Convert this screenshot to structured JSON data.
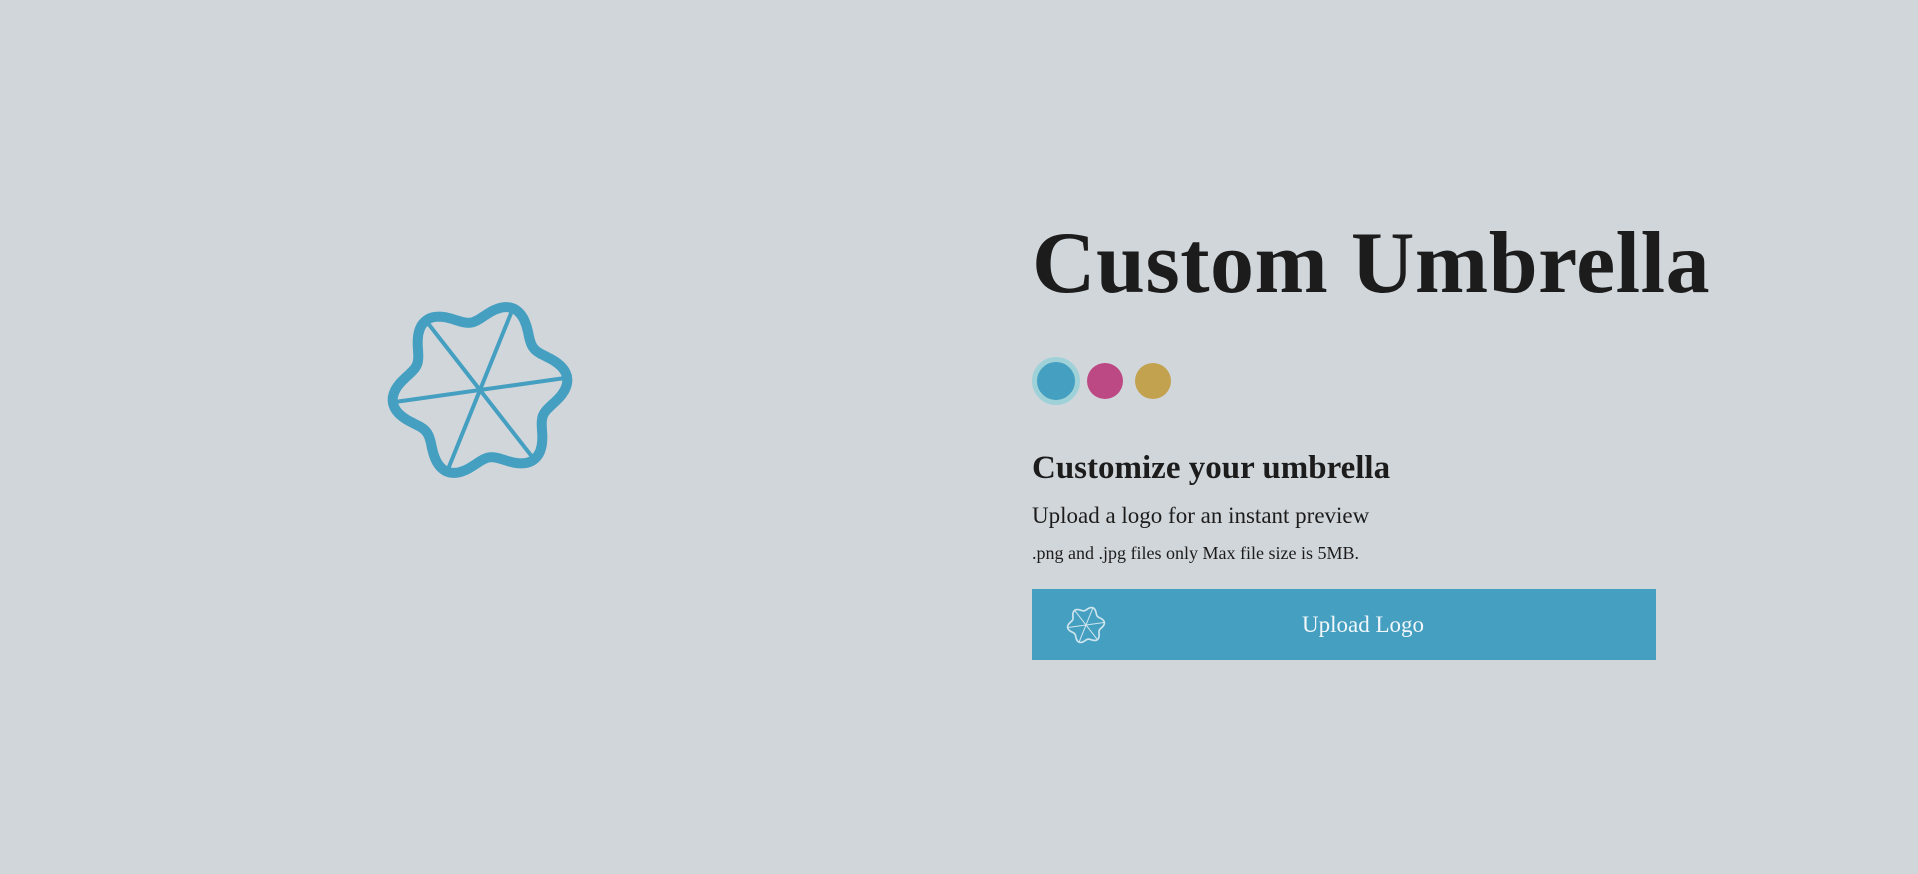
{
  "page": {
    "background": "#d1d6da"
  },
  "preview": {
    "icon": "umbrella-icon",
    "color": "#449fc1"
  },
  "header": {
    "title": "Custom Umbrella"
  },
  "colors": {
    "options": [
      {
        "name": "blue",
        "hex": "#449fc1",
        "selected": true
      },
      {
        "name": "pink",
        "hex": "#bd4984",
        "selected": false
      },
      {
        "name": "gold",
        "hex": "#c3a24f",
        "selected": false
      }
    ],
    "selected_ring": "#9fd2d8"
  },
  "customize": {
    "heading": "Customize your umbrella",
    "description": "Upload a logo for an instant preview",
    "note": ".png and .jpg files only Max file size is 5MB."
  },
  "upload": {
    "label": "Upload Logo",
    "icon": "umbrella-icon",
    "background": "#449fc1"
  }
}
